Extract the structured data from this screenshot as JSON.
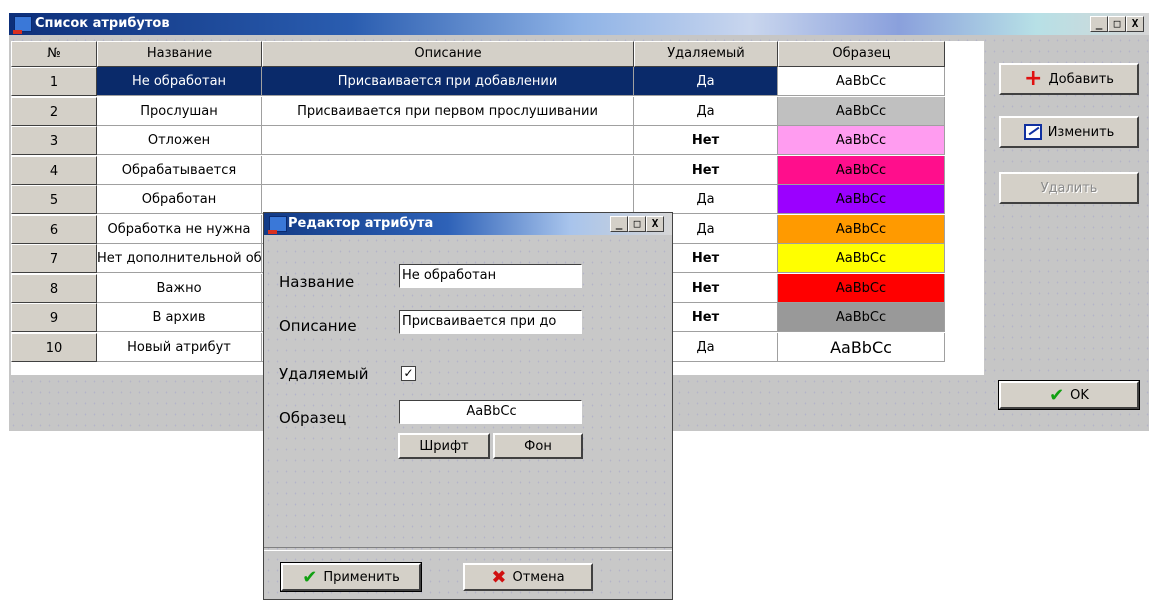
{
  "main_window": {
    "title": "Список атрибутов",
    "controls": {
      "minimize": "_",
      "maximize": "□",
      "close": "X"
    }
  },
  "grid": {
    "columns": [
      "№",
      "Название",
      "Описание",
      "Удаляемый",
      "Образец"
    ],
    "rows": [
      {
        "num": "1",
        "name": "Не обработан",
        "desc": "Присваивается при добавлении",
        "deletable": "Да",
        "sample": "AaBbCc",
        "sample_bg": "#ffffff",
        "sample_fg": "#000000",
        "selected": true
      },
      {
        "num": "2",
        "name": "Прослушан",
        "desc": "Присваивается при первом прослушивании",
        "deletable": "Да",
        "sample": "AaBbCc",
        "sample_bg": "#c0c0c0",
        "sample_fg": "#000000"
      },
      {
        "num": "3",
        "name": "Отложен",
        "desc": "",
        "deletable": "Нет",
        "sample": "AaBbCc",
        "sample_bg": "#ff9cf0",
        "sample_fg": "#000000"
      },
      {
        "num": "4",
        "name": "Обрабатывается",
        "desc": "",
        "deletable": "Нет",
        "sample": "AaBbCc",
        "sample_bg": "#ff0e8c",
        "sample_fg": "#000000"
      },
      {
        "num": "5",
        "name": "Обработан",
        "desc": "",
        "deletable": "Да",
        "sample": "AaBbCc",
        "sample_bg": "#9b00ff",
        "sample_fg": "#000000"
      },
      {
        "num": "6",
        "name": "Обработка не нужна",
        "desc": "",
        "deletable": "Да",
        "sample": "AaBbCc",
        "sample_bg": "#ff9a00",
        "sample_fg": "#000000"
      },
      {
        "num": "7",
        "name": "Нет дополнительной обр",
        "desc": "",
        "deletable": "Нет",
        "sample": "AaBbCc",
        "sample_bg": "#ffff00",
        "sample_fg": "#000000"
      },
      {
        "num": "8",
        "name": "Важно",
        "desc": "",
        "deletable": "Нет",
        "sample": "AaBbCc",
        "sample_bg": "#ff0000",
        "sample_fg": "#000000"
      },
      {
        "num": "9",
        "name": "В архив",
        "desc": "",
        "deletable": "Нет",
        "sample": "AaBbCc",
        "sample_bg": "#999999",
        "sample_fg": "#000000"
      },
      {
        "num": "10",
        "name": "Новый атрибут",
        "desc": "",
        "deletable": "Да",
        "sample": "AaBbCc",
        "sample_bg": "#ffffff",
        "sample_fg": "#000000"
      }
    ]
  },
  "side_buttons": {
    "add": "Добавить",
    "edit": "Изменить",
    "delete": "Удалить",
    "ok": "OK"
  },
  "dialog": {
    "title": "Редактор атрибута",
    "controls": {
      "minimize": "_",
      "maximize": "□",
      "close": "X"
    },
    "name_label": "Название",
    "name_value": "Не обработан",
    "desc_label": "Описание",
    "desc_value": "Присваивается при до",
    "deletable_label": "Удаляемый",
    "deletable_checked": "✓",
    "sample_label": "Образец",
    "sample_value": "AaBbCc",
    "font_button": "Шрифт",
    "bg_button": "Фон",
    "apply_button": "Применить",
    "cancel_button": "Отмена"
  }
}
